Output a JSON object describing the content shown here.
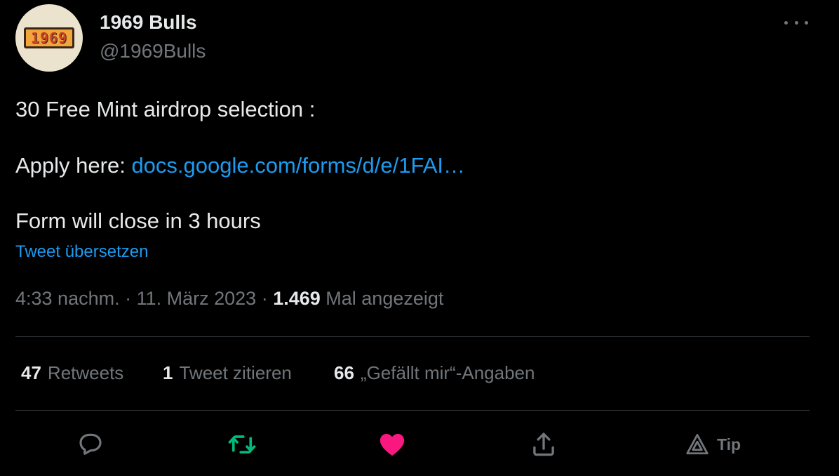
{
  "author": {
    "display_name": "1969 Bulls",
    "handle": "@1969Bulls",
    "avatar_text": "1969"
  },
  "tweet": {
    "line1": "30 Free Mint airdrop selection :",
    "line2_prefix": "Apply here: ",
    "link_text": "docs.google.com/forms/d/e/1FAI…",
    "line3": "Form will close in 3 hours",
    "translate_label": "Tweet übersetzen"
  },
  "meta": {
    "time": "4:33 nachm.",
    "separator1": " · ",
    "date": "11. März 2023",
    "separator2": " · ",
    "views_count": "1.469",
    "views_label": " Mal angezeigt"
  },
  "stats": {
    "retweets_count": "47",
    "retweets_label": "Retweets",
    "quotes_count": "1",
    "quotes_label": "Tweet zitieren",
    "likes_count": "66",
    "likes_label": "„Gefällt mir“-Angaben"
  },
  "actions": {
    "reply_icon": "reply-icon",
    "retweet_icon": "retweet-icon",
    "like_icon": "heart-icon",
    "share_icon": "share-icon",
    "tip_icon": "tip-icon",
    "tip_label": "Tip"
  },
  "colors": {
    "background": "#000000",
    "text": "#e7e9ea",
    "secondary": "#71767b",
    "link": "#1d9bf0",
    "retweet_green": "#00ba7c",
    "like_pink": "#f91880"
  }
}
